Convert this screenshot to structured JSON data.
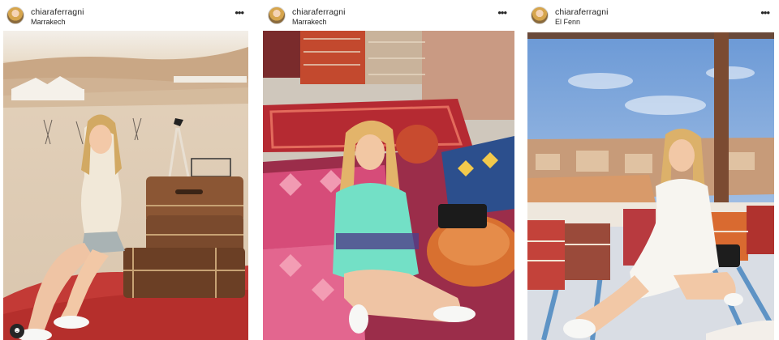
{
  "posts": [
    {
      "username": "chiaraferragni",
      "location": "Marrakech",
      "more_icon": "more-horizontal-icon"
    },
    {
      "username": "chiaraferragni",
      "location": "Marrakech",
      "more_icon": "more-horizontal-icon"
    },
    {
      "username": "chiaraferragni",
      "location": "El Fenn",
      "more_icon": "more-horizontal-icon"
    }
  ],
  "tag_icon": "user-tag-icon",
  "colors": {
    "text": "#262626",
    "background": "#ffffff"
  }
}
